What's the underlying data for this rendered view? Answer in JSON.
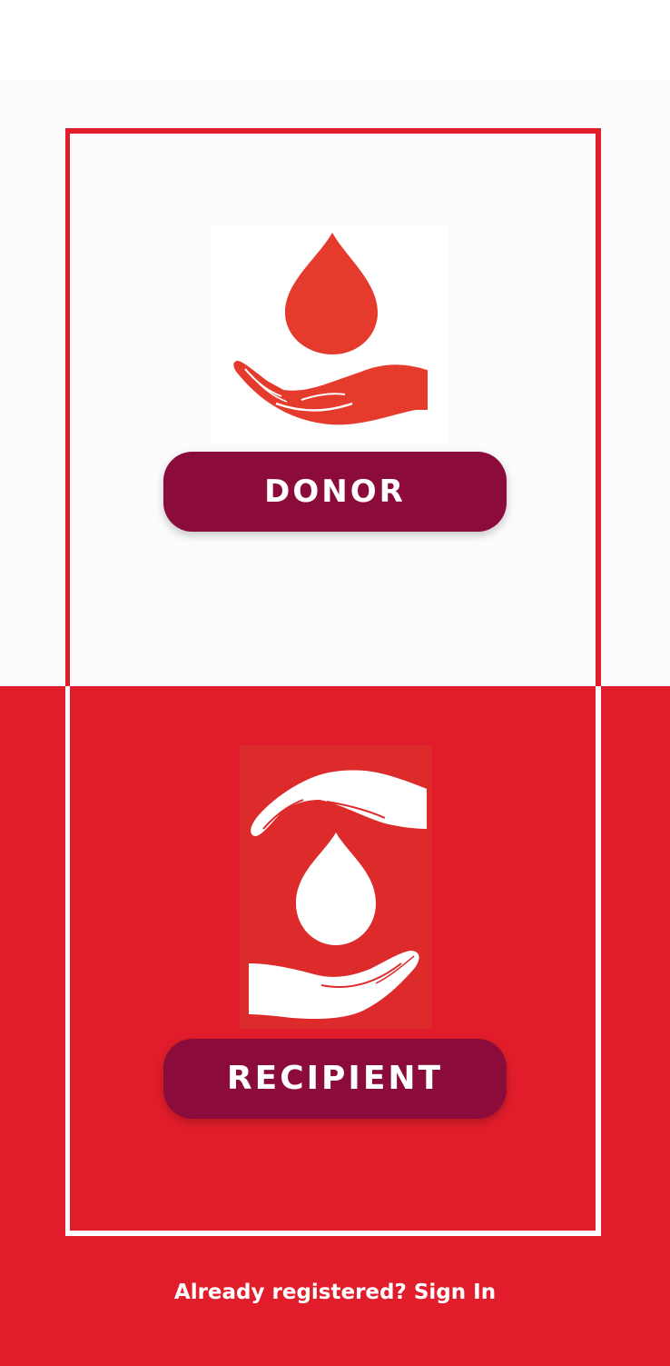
{
  "colors": {
    "primary_red": "#e21d2b",
    "button_maroon": "#8b0c3b",
    "art_red": "#e53b2d",
    "white": "#ffffff"
  },
  "donor": {
    "icon": "blood-drop-on-hand-icon",
    "button_label": "DONOR"
  },
  "recipient": {
    "icon": "hands-around-blood-drop-icon",
    "button_label": "RECIPIENT"
  },
  "footer": {
    "signin_text": "Already registered? Sign In"
  }
}
